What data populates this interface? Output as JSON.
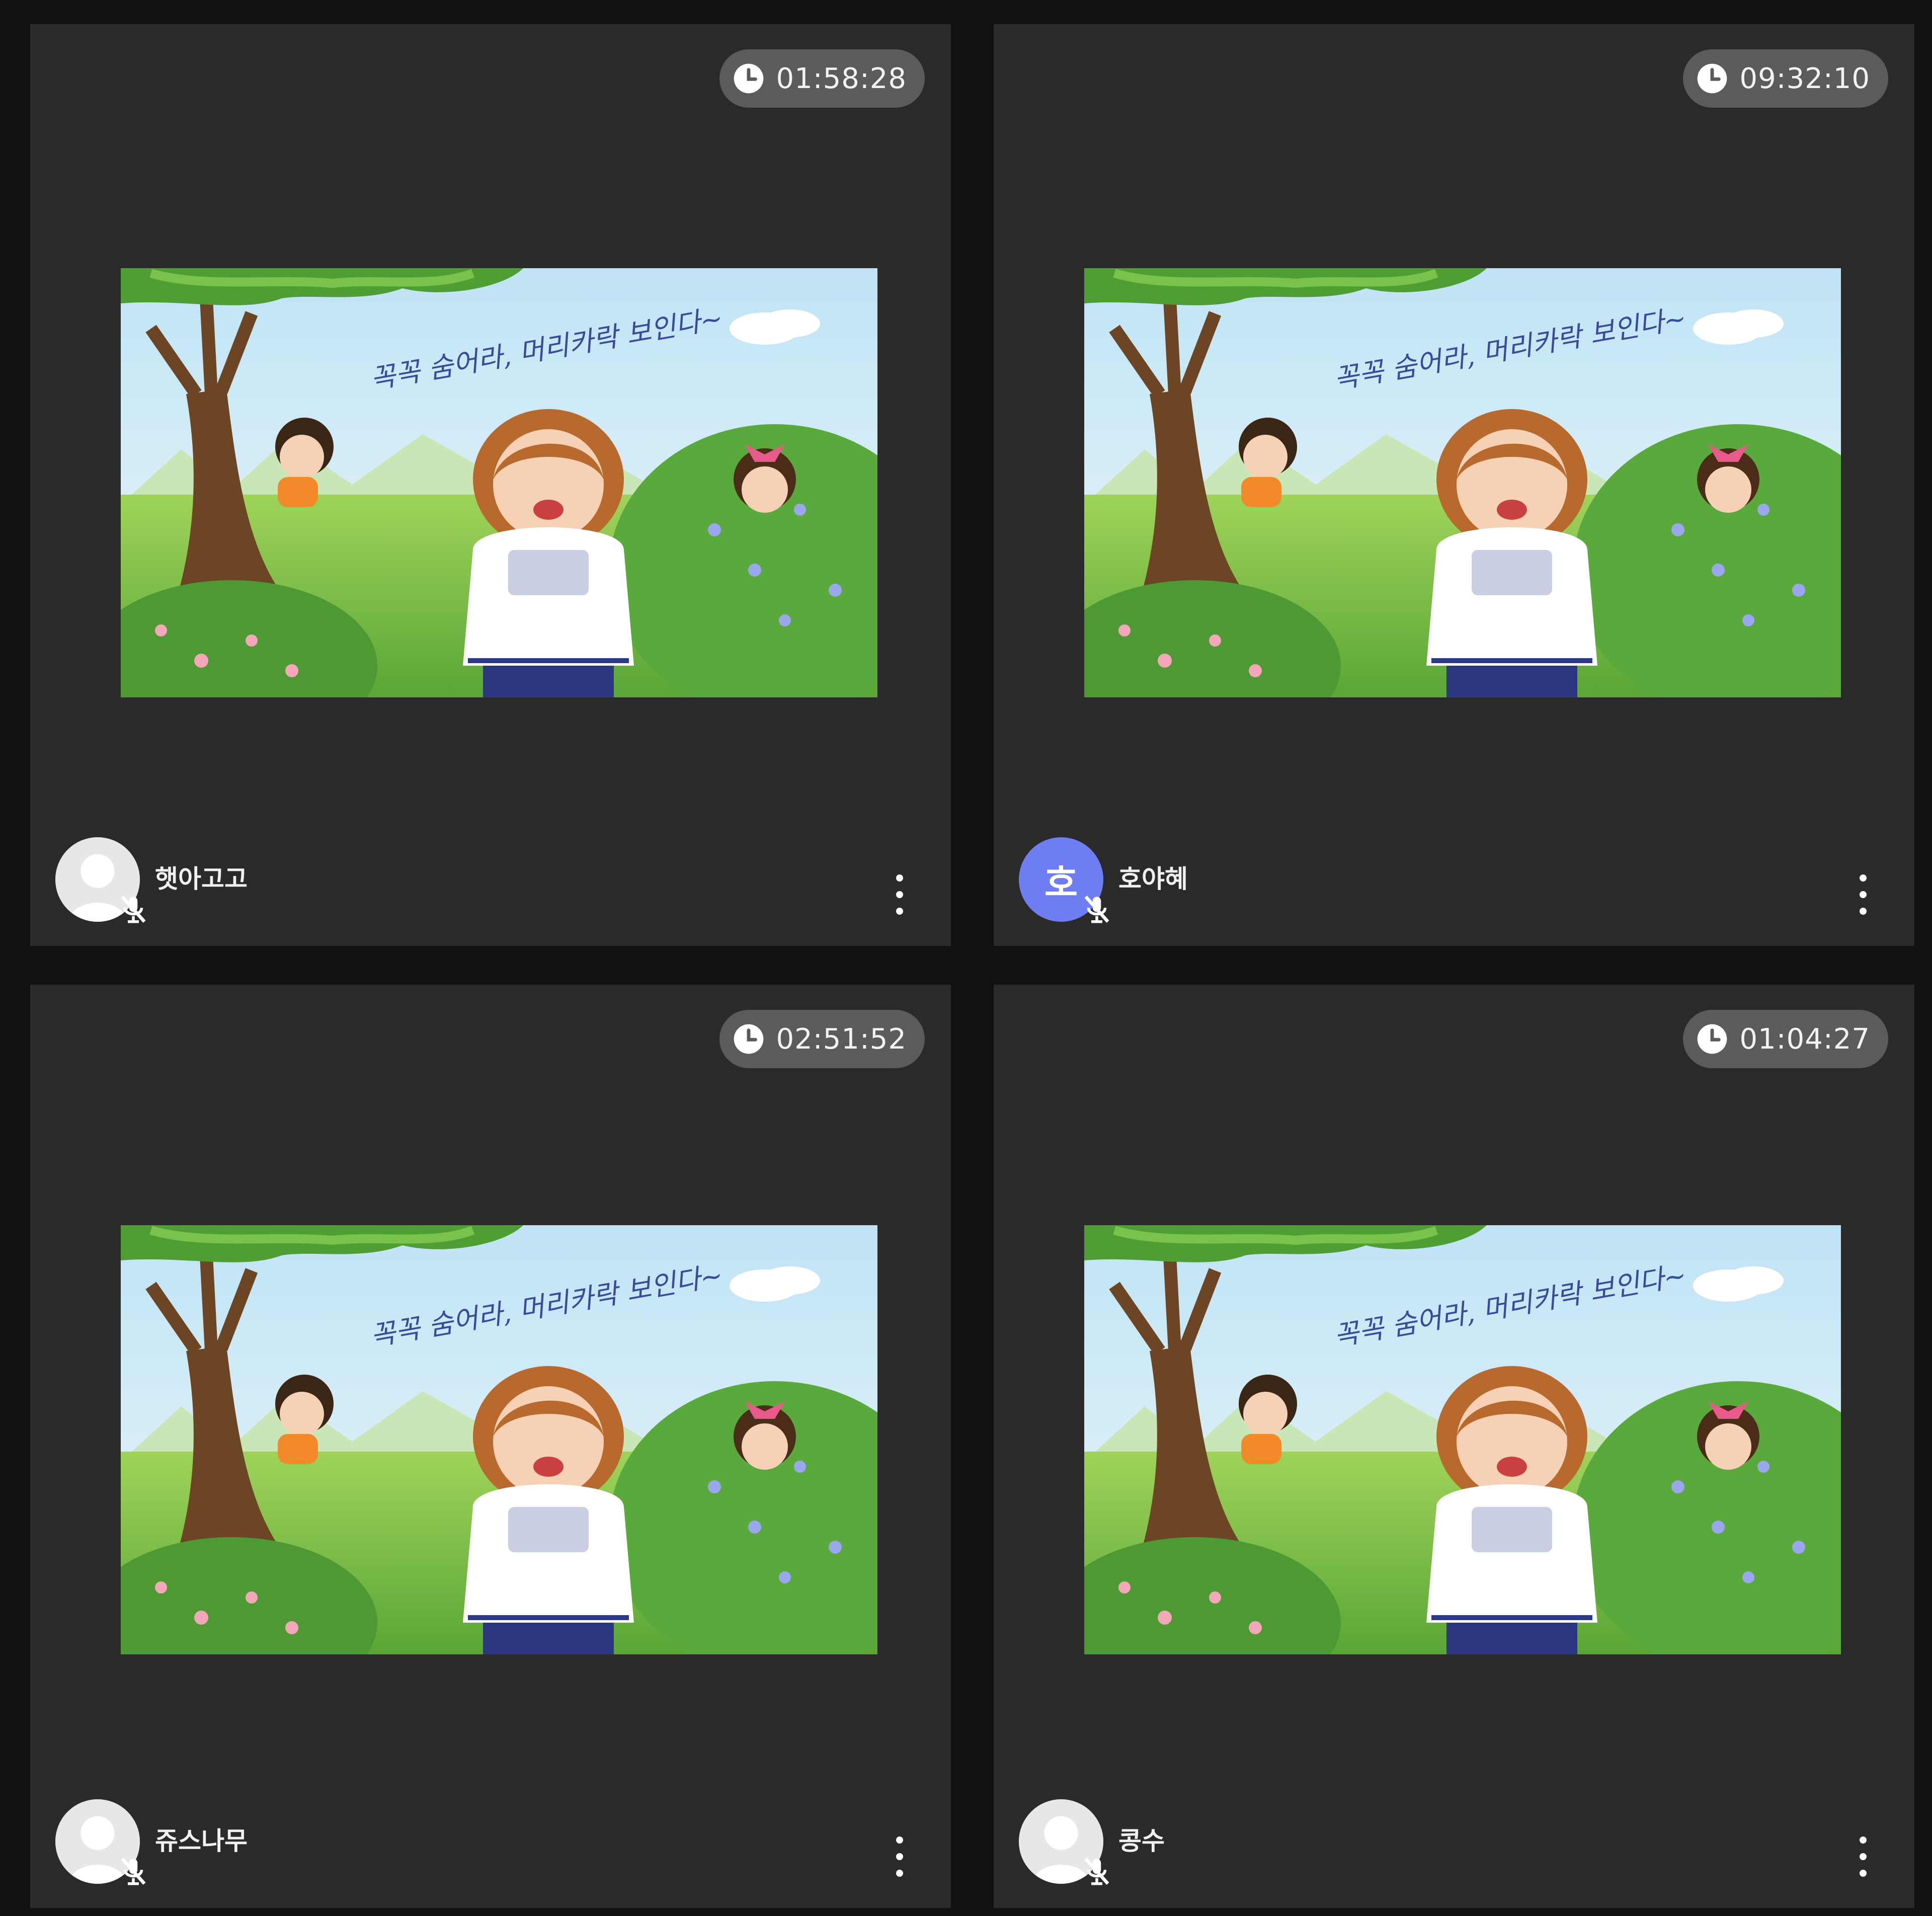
{
  "participants": [
    {
      "timer": "01:58:28",
      "name": "햇아고고",
      "avatar_type": "photo",
      "avatar_letter": "",
      "mic_icon": "mic-off-icon",
      "menu_icon": "more-vert-icon"
    },
    {
      "timer": "09:32:10",
      "name": "호야혜",
      "avatar_type": "letter",
      "avatar_letter": "호",
      "mic_icon": "mic-off-icon",
      "menu_icon": "more-vert-icon"
    },
    {
      "timer": "02:51:52",
      "name": "쥬스나무",
      "avatar_type": "photo",
      "avatar_letter": "",
      "mic_icon": "mic-off-icon",
      "menu_icon": "more-vert-icon"
    },
    {
      "timer": "01:04:27",
      "name": "콩수",
      "avatar_type": "photo",
      "avatar_letter": "",
      "mic_icon": "mic-off-icon",
      "menu_icon": "more-vert-icon"
    }
  ],
  "video_caption": "꼭꼭 숨어라, 머리카락 보인다~",
  "colors": {
    "background": "#111112",
    "tile": "#2a2a2b",
    "timer_pill": "#5b5b5c",
    "letter_avatar": "#6e7ef2"
  }
}
